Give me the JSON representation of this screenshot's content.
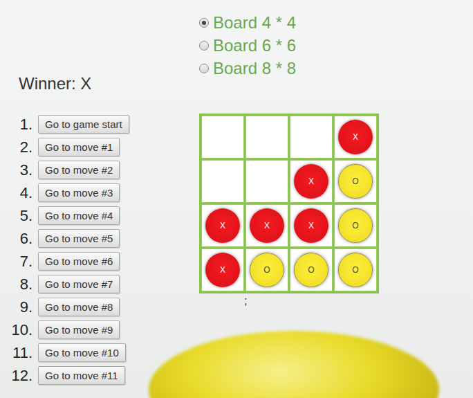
{
  "board_options": [
    {
      "label": "Board 4 * 4",
      "selected": true
    },
    {
      "label": "Board 6 * 6",
      "selected": false
    },
    {
      "label": "Board 8 * 8",
      "selected": false
    }
  ],
  "winner": "Winner: X",
  "moves": [
    {
      "number": "1.",
      "label": "Go to game start"
    },
    {
      "number": "2.",
      "label": "Go to move #1"
    },
    {
      "number": "3.",
      "label": "Go to move #2"
    },
    {
      "number": "4.",
      "label": "Go to move #3"
    },
    {
      "number": "5.",
      "label": "Go to move #4"
    },
    {
      "number": "6.",
      "label": "Go to move #5"
    },
    {
      "number": "7.",
      "label": "Go to move #6"
    },
    {
      "number": "8.",
      "label": "Go to move #7"
    },
    {
      "number": "9.",
      "label": "Go to move #8"
    },
    {
      "number": "10.",
      "label": "Go to move #9"
    },
    {
      "number": "11.",
      "label": "Go to move #10"
    },
    {
      "number": "12.",
      "label": "Go to move #11"
    }
  ],
  "board": {
    "rows": [
      [
        {
          "kind": "empty"
        },
        {
          "kind": "empty"
        },
        {
          "kind": "empty"
        },
        {
          "kind": "x",
          "text": "X"
        }
      ],
      [
        {
          "kind": "empty"
        },
        {
          "kind": "empty"
        },
        {
          "kind": "x",
          "text": "X"
        },
        {
          "kind": "o",
          "text": "O"
        }
      ],
      [
        {
          "kind": "x",
          "text": "X"
        },
        {
          "kind": "x",
          "text": "X"
        },
        {
          "kind": "x",
          "text": "X"
        },
        {
          "kind": "o",
          "text": "O"
        }
      ],
      [
        {
          "kind": "x",
          "text": "X"
        },
        {
          "kind": "o",
          "text": "O"
        },
        {
          "kind": "o",
          "text": "O"
        },
        {
          "kind": "o",
          "text": "O"
        }
      ]
    ]
  },
  "footer": ";"
}
